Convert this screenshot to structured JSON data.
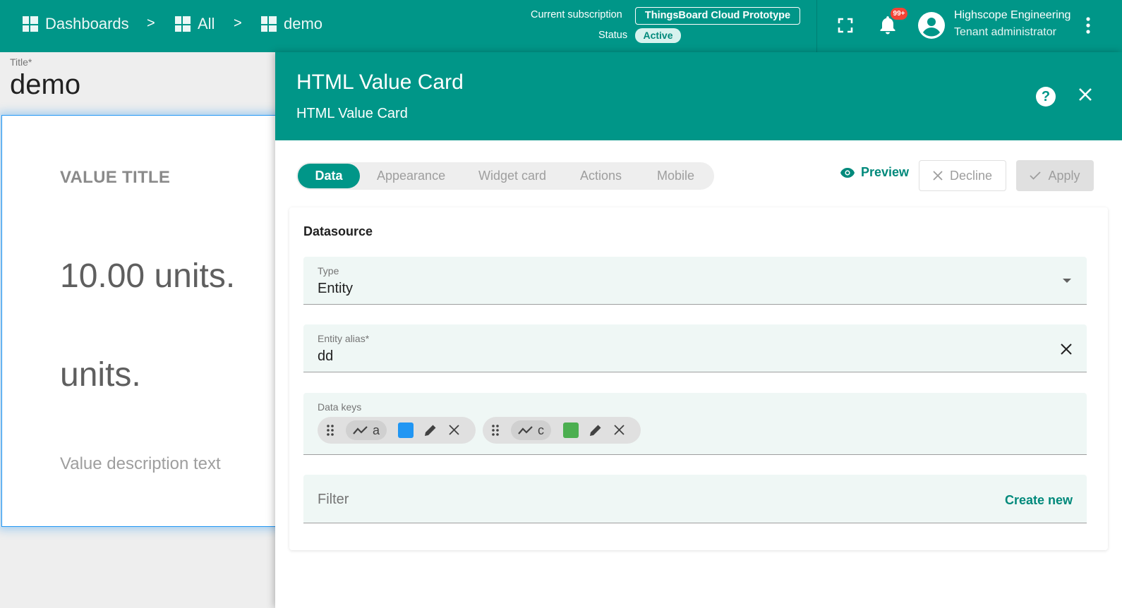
{
  "topbar": {
    "breadcrumbs": [
      {
        "label": "Dashboards"
      },
      {
        "label": "All"
      },
      {
        "label": "demo"
      }
    ],
    "separator": ">",
    "subscription_label": "Current subscription",
    "subscription_value": "ThingsBoard Cloud Prototype",
    "status_label": "Status",
    "status_value": "Active",
    "notification_badge": "99+",
    "user": {
      "name": "Highscope Engineering",
      "role": "Tenant administrator"
    },
    "icons": [
      "fullscreen-icon",
      "bell-icon",
      "account-icon",
      "more-vert-icon"
    ],
    "accent_color": "#009688"
  },
  "dashboard": {
    "title_label": "Title*",
    "title_value": "demo",
    "widget": {
      "value_title": "VALUE TITLE",
      "value": "10.00 units.",
      "units": "units.",
      "description": "Value description text"
    }
  },
  "panel": {
    "title": "HTML Value Card",
    "subtitle": "HTML Value Card",
    "tabs": [
      {
        "label": "Data",
        "active": true
      },
      {
        "label": "Appearance"
      },
      {
        "label": "Widget card"
      },
      {
        "label": "Actions"
      },
      {
        "label": "Mobile"
      }
    ],
    "preview_label": "Preview",
    "decline_label": "Decline",
    "apply_label": "Apply",
    "datasource": {
      "title": "Datasource",
      "type_label": "Type",
      "type_value": "Entity",
      "alias_label": "Entity alias*",
      "alias_value": "dd",
      "data_keys_label": "Data keys",
      "data_keys": [
        {
          "key": "a",
          "color": "#2196f3"
        },
        {
          "key": "c",
          "color": "#4caf50"
        }
      ],
      "filter_label": "Filter",
      "create_new_label": "Create new"
    }
  }
}
